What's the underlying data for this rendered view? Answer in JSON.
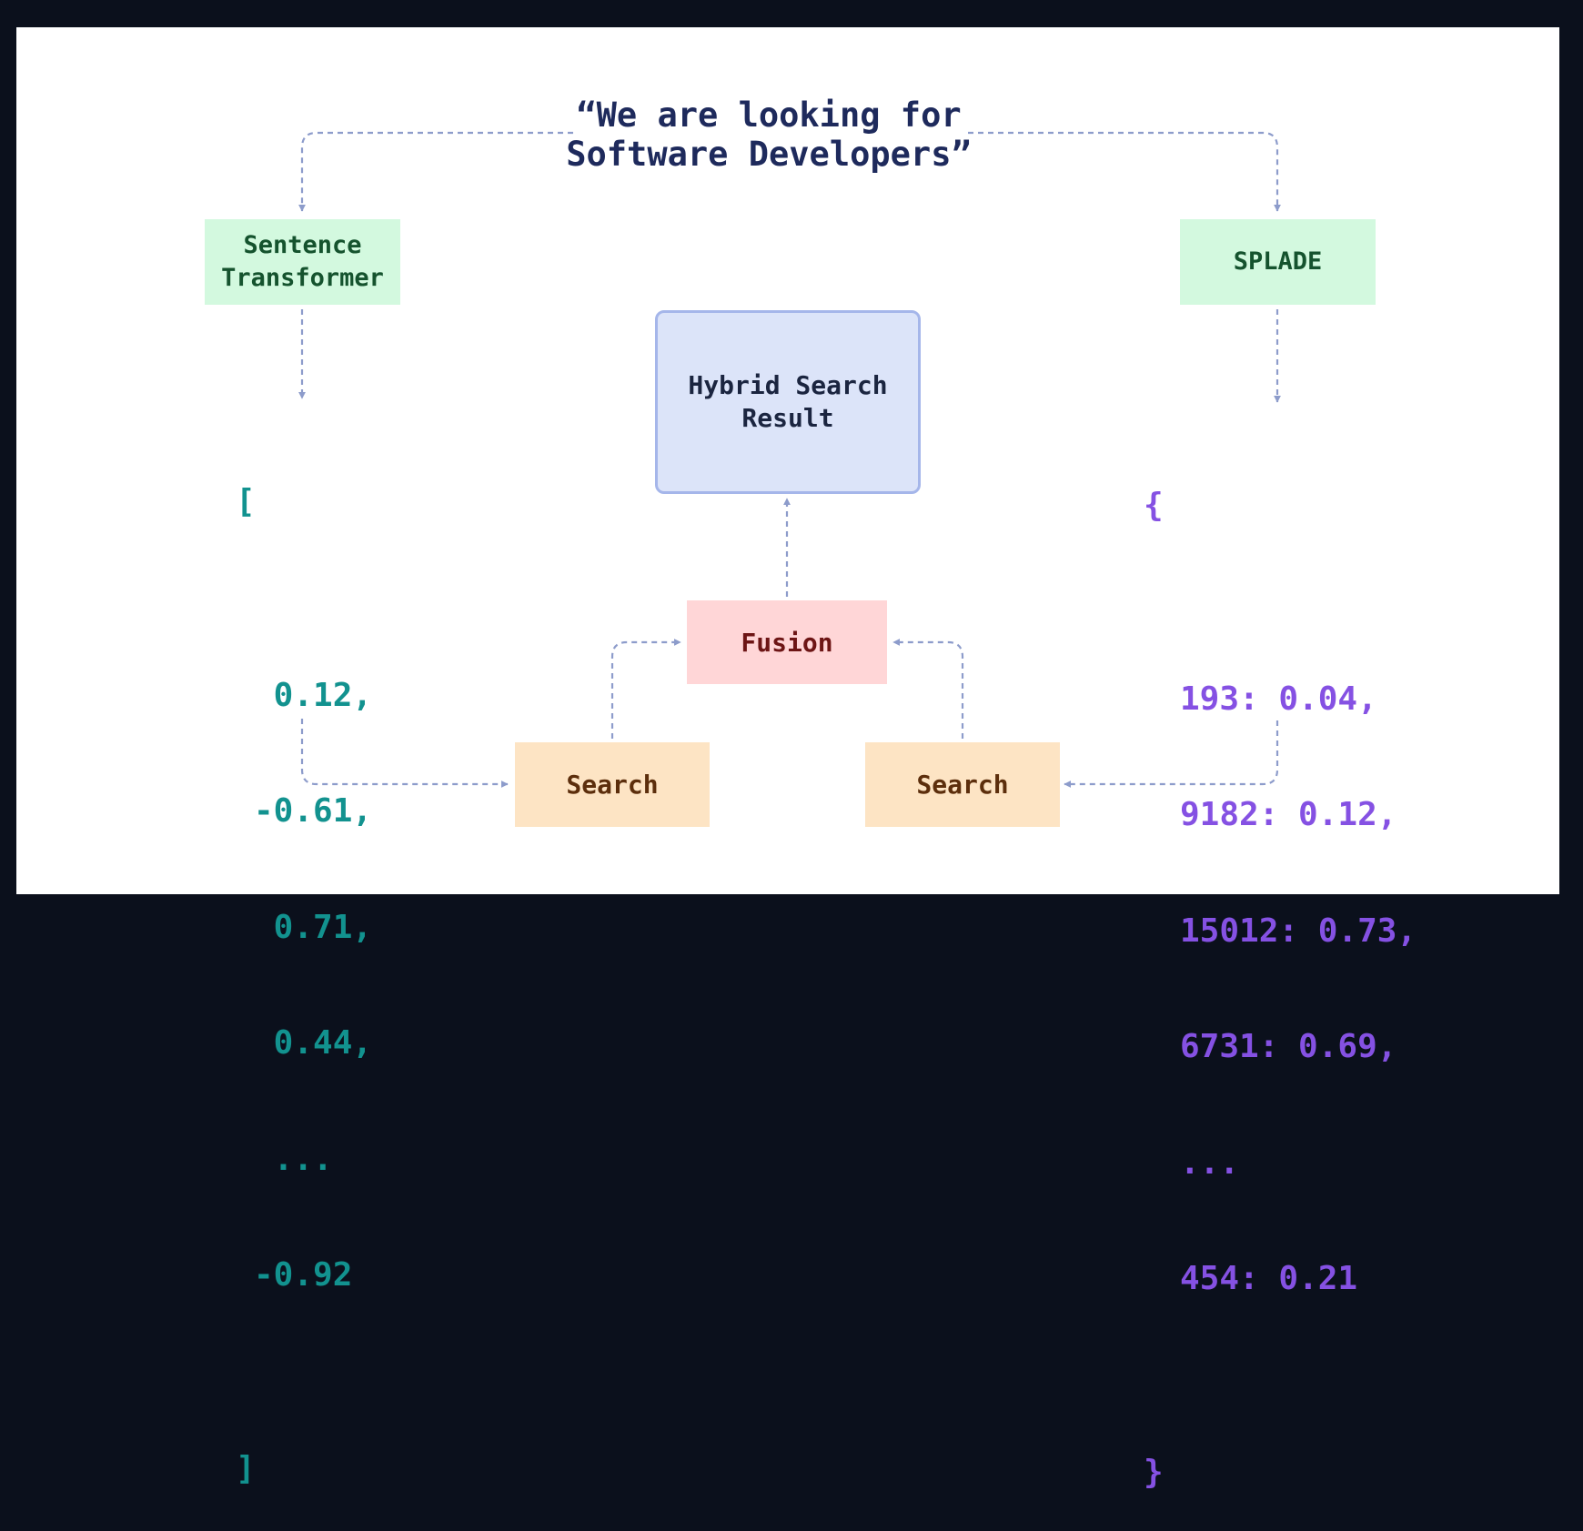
{
  "query": {
    "line1": "“We are looking for",
    "line2": "Software Developers”"
  },
  "encoders": {
    "dense": {
      "line1": "Sentence",
      "line2": "Transformer"
    },
    "sparse": {
      "label": "SPLADE"
    }
  },
  "result": {
    "line1": "Hybrid Search",
    "line2": "Result"
  },
  "fusion": {
    "label": "Fusion"
  },
  "search": {
    "left_label": "Search",
    "right_label": "Search"
  },
  "dense_vector": {
    "open": "[",
    "values": [
      " 0.12,",
      "-0.61,",
      " 0.71,",
      " 0.44,",
      " ...",
      "-0.92"
    ],
    "close": "]"
  },
  "sparse_vector": {
    "open": "{",
    "entries": [
      "193: 0.04,",
      "9182: 0.12,",
      "15012: 0.73,",
      "6731: 0.69,",
      "...",
      "454: 0.21"
    ],
    "close": "}"
  },
  "colors": {
    "arrow": "#8d9ccb",
    "dense_text": "#12928f",
    "sparse_text": "#8551e3",
    "encoder_fill": "#d3f9df",
    "result_fill": "#dce4f9",
    "fusion_fill": "#ffd6d7",
    "search_fill": "#fde4c4"
  }
}
